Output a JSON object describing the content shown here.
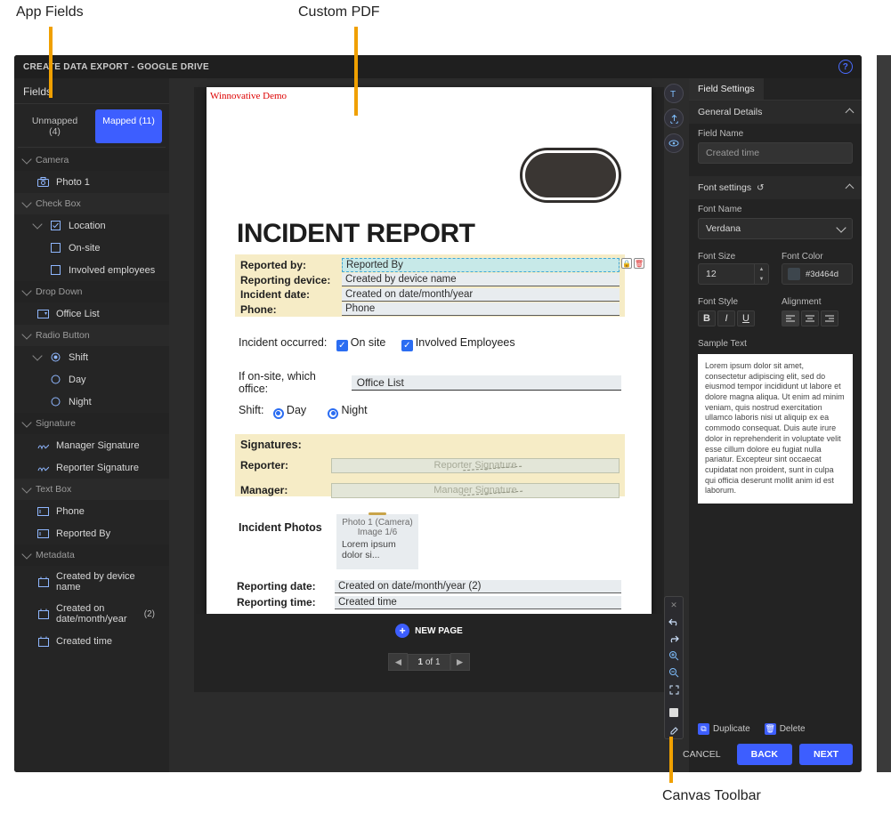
{
  "annotations": {
    "app_fields": "App Fields",
    "custom_pdf": "Custom PDF",
    "canvas_toolbar": "Canvas Toolbar"
  },
  "titlebar": {
    "text": "CREATE DATA EXPORT - GOOGLE DRIVE"
  },
  "sidebar": {
    "heading": "Fields",
    "tabs": {
      "unmapped": "Unmapped (4)",
      "mapped": "Mapped (11)"
    },
    "groups": {
      "camera": {
        "label": "Camera",
        "items": {
          "photo1": "Photo 1"
        }
      },
      "checkbox": {
        "label": "Check Box",
        "location": {
          "label": "Location",
          "onsite": "On-site",
          "involved": "Involved employees"
        }
      },
      "dropdown": {
        "label": "Drop Down",
        "office": "Office List"
      },
      "radio": {
        "label": "Radio Button",
        "shift": {
          "label": "Shift",
          "day": "Day",
          "night": "Night"
        }
      },
      "signature": {
        "label": "Signature",
        "manager": "Manager Signature",
        "reporter": "Reporter Signature"
      },
      "textbox": {
        "label": "Text Box",
        "phone": "Phone",
        "reportedby": "Reported By"
      },
      "metadata": {
        "label": "Metadata",
        "device": "Created by device name",
        "created_on": "Created on date/month/year",
        "created_on_cnt": "(2)",
        "created_time": "Created time"
      }
    }
  },
  "doc": {
    "watermark": "Winnovative Demo",
    "title": "INCIDENT REPORT",
    "rows1": {
      "reported_by_lab": "Reported by:",
      "reported_by_val": "Reported By",
      "device_lab": "Reporting device:",
      "device_val": "Created by device name",
      "incident_date_lab": "Incident date:",
      "incident_date_val": "Created on date/month/year",
      "phone_lab": "Phone:",
      "phone_val": "Phone"
    },
    "occurred": {
      "lab": "Incident occurred:",
      "onsite": "On site",
      "involved": "Involved Employees"
    },
    "office": {
      "lab": "If on-site, which office:",
      "val": "Office List"
    },
    "shift": {
      "lab": "Shift:",
      "day": "Day",
      "night": "Night"
    },
    "sig": {
      "heading": "Signatures:",
      "reporter_lab": "Reporter:",
      "reporter_val": "Reporter Signature",
      "manager_lab": "Manager:",
      "manager_val": "Manager Signature"
    },
    "photos": {
      "lab": "Incident Photos",
      "cap1": "Photo 1 (Camera)",
      "cap2": "Image 1/6",
      "lorem": "Lorem ipsum dolor si..."
    },
    "report2": {
      "date_lab": "Reporting date:",
      "date_val": "Created on date/month/year (2)",
      "time_lab": "Reporting time:",
      "time_val": "Created time"
    },
    "pager": {
      "newpage": "NEW PAGE",
      "pg_a": "1",
      "pg_of": "of",
      "pg_b": "1"
    }
  },
  "rpanel": {
    "tab": "Field Settings",
    "general": "General Details",
    "fieldname_lab": "Field Name",
    "fieldname_val": "Created time",
    "fontset": "Font settings",
    "fontname_lab": "Font Name",
    "fontname_val": "Verdana",
    "fontsize_lab": "Font Size",
    "fontsize_val": "12",
    "fontcolor_lab": "Font Color",
    "fontcolor_val": "#3d464d",
    "fontstyle_lab": "Font Style",
    "alignment_lab": "Alignment",
    "sample_lab": "Sample Text",
    "sample_text": "Lorem ipsum dolor sit amet, consectetur adipiscing elit, sed do eiusmod tempor incididunt ut labore et dolore magna aliqua. Ut enim ad minim veniam, quis nostrud exercitation ullamco laboris nisi ut aliquip ex ea commodo consequat. Duis aute irure dolor in reprehenderit in voluptate velit esse cillum dolore eu fugiat nulla pariatur. Excepteur sint occaecat cupidatat non proident, sunt in culpa qui officia deserunt mollit anim id est laborum.",
    "duplicate": "Duplicate",
    "delete": "Delete",
    "cancel": "CANCEL",
    "back": "BACK",
    "next": "NEXT"
  }
}
